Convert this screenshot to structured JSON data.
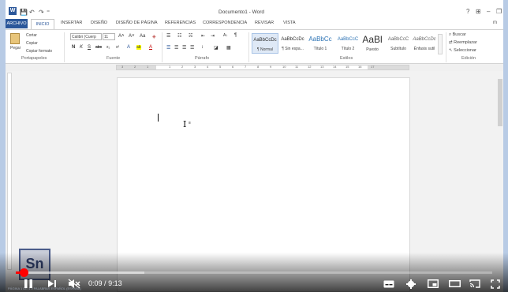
{
  "app": {
    "document_title": "Documento1 - Word",
    "word_logo": "W",
    "account": "m"
  },
  "quick_access": {
    "save": "💾",
    "undo": "↶",
    "redo": "↷",
    "customize": "⁼"
  },
  "window_controls": {
    "help": "?",
    "ribbon_options": "⊞",
    "minimize": "–",
    "restore": "❐"
  },
  "tabs": [
    {
      "label": "ARCHIVO"
    },
    {
      "label": "INICIO"
    },
    {
      "label": "INSERTAR"
    },
    {
      "label": "DISEÑO"
    },
    {
      "label": "DISEÑO DE PÁGINA"
    },
    {
      "label": "REFERENCIAS"
    },
    {
      "label": "CORRESPONDENCIA"
    },
    {
      "label": "REVISAR"
    },
    {
      "label": "VISTA"
    }
  ],
  "ribbon": {
    "clipboard": {
      "paste": "Pegar",
      "cut": "Cortar",
      "copy": "Copiar",
      "format_painter": "Copiar formato",
      "group": "Portapapeles"
    },
    "font": {
      "family": "Calibri (Cuerp",
      "size": "11",
      "grow": "A˄",
      "shrink": "A˅",
      "case": "Aa",
      "clear": "◈",
      "bold": "N",
      "italic": "K",
      "underline": "S",
      "strike": "abc",
      "subscript": "x₂",
      "superscript": "x²",
      "effects": "A",
      "highlight": "ab",
      "color": "A",
      "group": "Fuente"
    },
    "paragraph": {
      "bullets": "☰",
      "numbering": "☷",
      "multilevel": "☵",
      "decrease_indent": "⇤",
      "increase_indent": "⇥",
      "sort": "A↓",
      "show_marks": "¶",
      "align_left": "☰",
      "center": "☰",
      "align_right": "☰",
      "justify": "☰",
      "line_spacing": "↕",
      "shading": "◪",
      "borders": "▦",
      "group": "Párrafo"
    },
    "styles": {
      "items": [
        {
          "sample": "AaBbCcDc",
          "name": "¶ Normal"
        },
        {
          "sample": "AaBbCcDc",
          "name": "¶ Sin espa..."
        },
        {
          "sample": "AaBbCc",
          "name": "Título 1"
        },
        {
          "sample": "AaBbCcC",
          "name": "Título 2"
        },
        {
          "sample": "AaBl",
          "name": "Puesto"
        },
        {
          "sample": "AaBbCcC",
          "name": "Subtítulo"
        },
        {
          "sample": "AaBbCcDc",
          "name": "Énfasis sutil"
        }
      ],
      "group": "Estilos"
    },
    "editing": {
      "find": "Buscar",
      "replace": "Reemplazar",
      "select": "Seleccionar",
      "group": "Edición"
    }
  },
  "ruler": {
    "numbers": [
      "3",
      "2",
      "1",
      "1",
      "2",
      "3",
      "4",
      "5",
      "6",
      "7",
      "8",
      "9",
      "10",
      "11",
      "12",
      "13",
      "14",
      "15",
      "16",
      "17"
    ]
  },
  "cursor": {
    "ibeam": "I",
    "ibeam_mark": "≡"
  },
  "watermark": {
    "text": "Sn"
  },
  "video": {
    "time_current": "0:09",
    "time_separator": "/",
    "time_total": "9:13",
    "progress_fraction": 0.016,
    "buffer_fraction": 0.27
  },
  "status_bar": {
    "text": "PÁGINA 1 DE 1    0 PALABRAS    ESPAÑOL (ESPAÑA)"
  },
  "colors": {
    "word_blue": "#2b579a",
    "progress_red": "#ff0000"
  }
}
